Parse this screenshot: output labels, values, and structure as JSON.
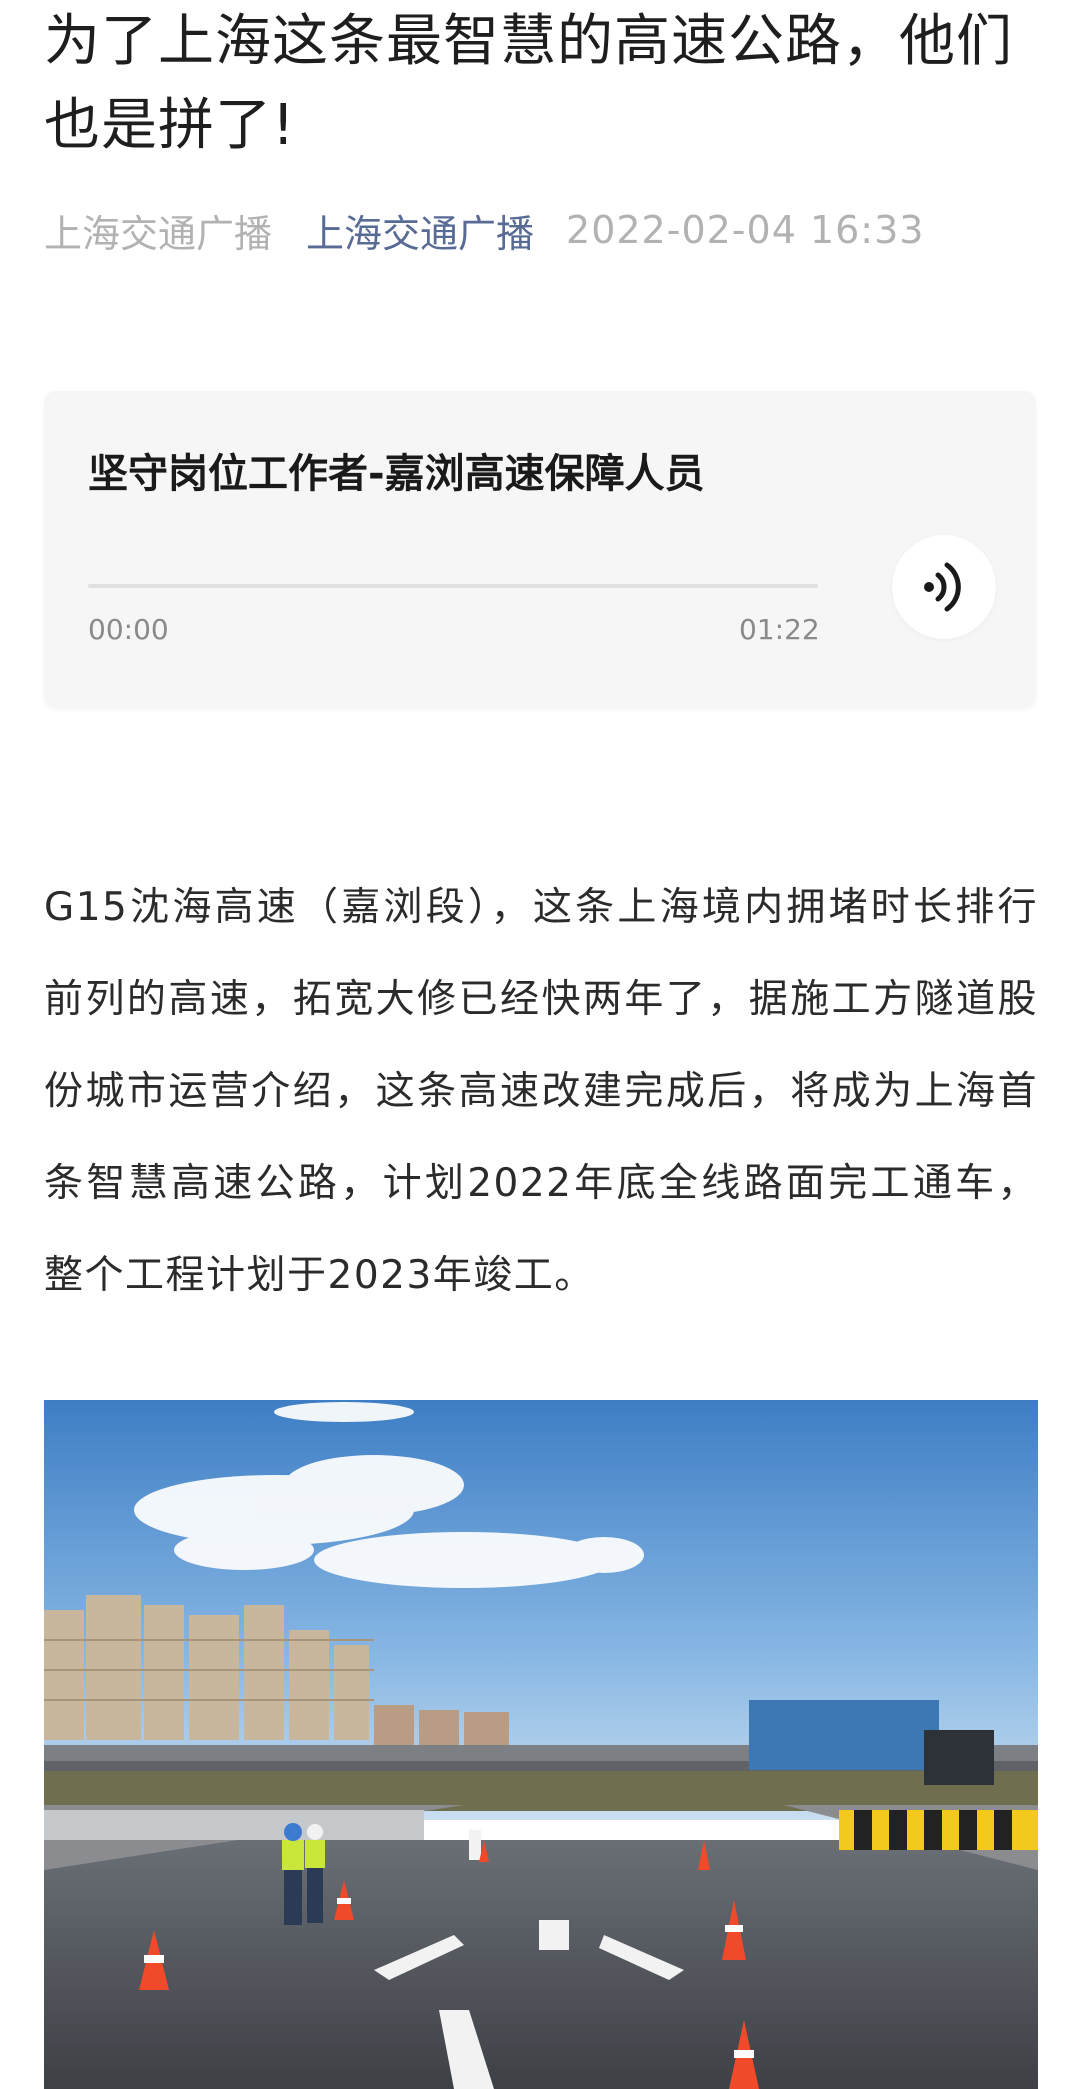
{
  "article": {
    "title": "为了上海这条最智慧的高速公路，他们也是拼了!",
    "author": "上海交通广播",
    "account": "上海交通广播",
    "publish_time": "2022-02-04 16:33"
  },
  "audio": {
    "title": "坚守岗位工作者-嘉浏高速保障人员",
    "current_time": "00:00",
    "duration": "01:22",
    "progress": 0,
    "icon": "audio-play-icon"
  },
  "content": {
    "paragraph_1": "G15沈海高速（嘉浏段），这条上海境内拥堵时长排行前列的高速，拓宽大修已经快两年了，据施工方隧道股份城市运营介绍，这条高速改建完成后，将成为上海首条智慧高速公路，计划2022年底全线路面完工通车，整个工程计划于2023年竣工。"
  },
  "colors": {
    "link_blue": "#576b95",
    "meta_gray": "#b2b2b2",
    "sky_top": "#3f7fc4",
    "road_dark": "#4a4d52",
    "cone_orange": "#f04a2a"
  }
}
